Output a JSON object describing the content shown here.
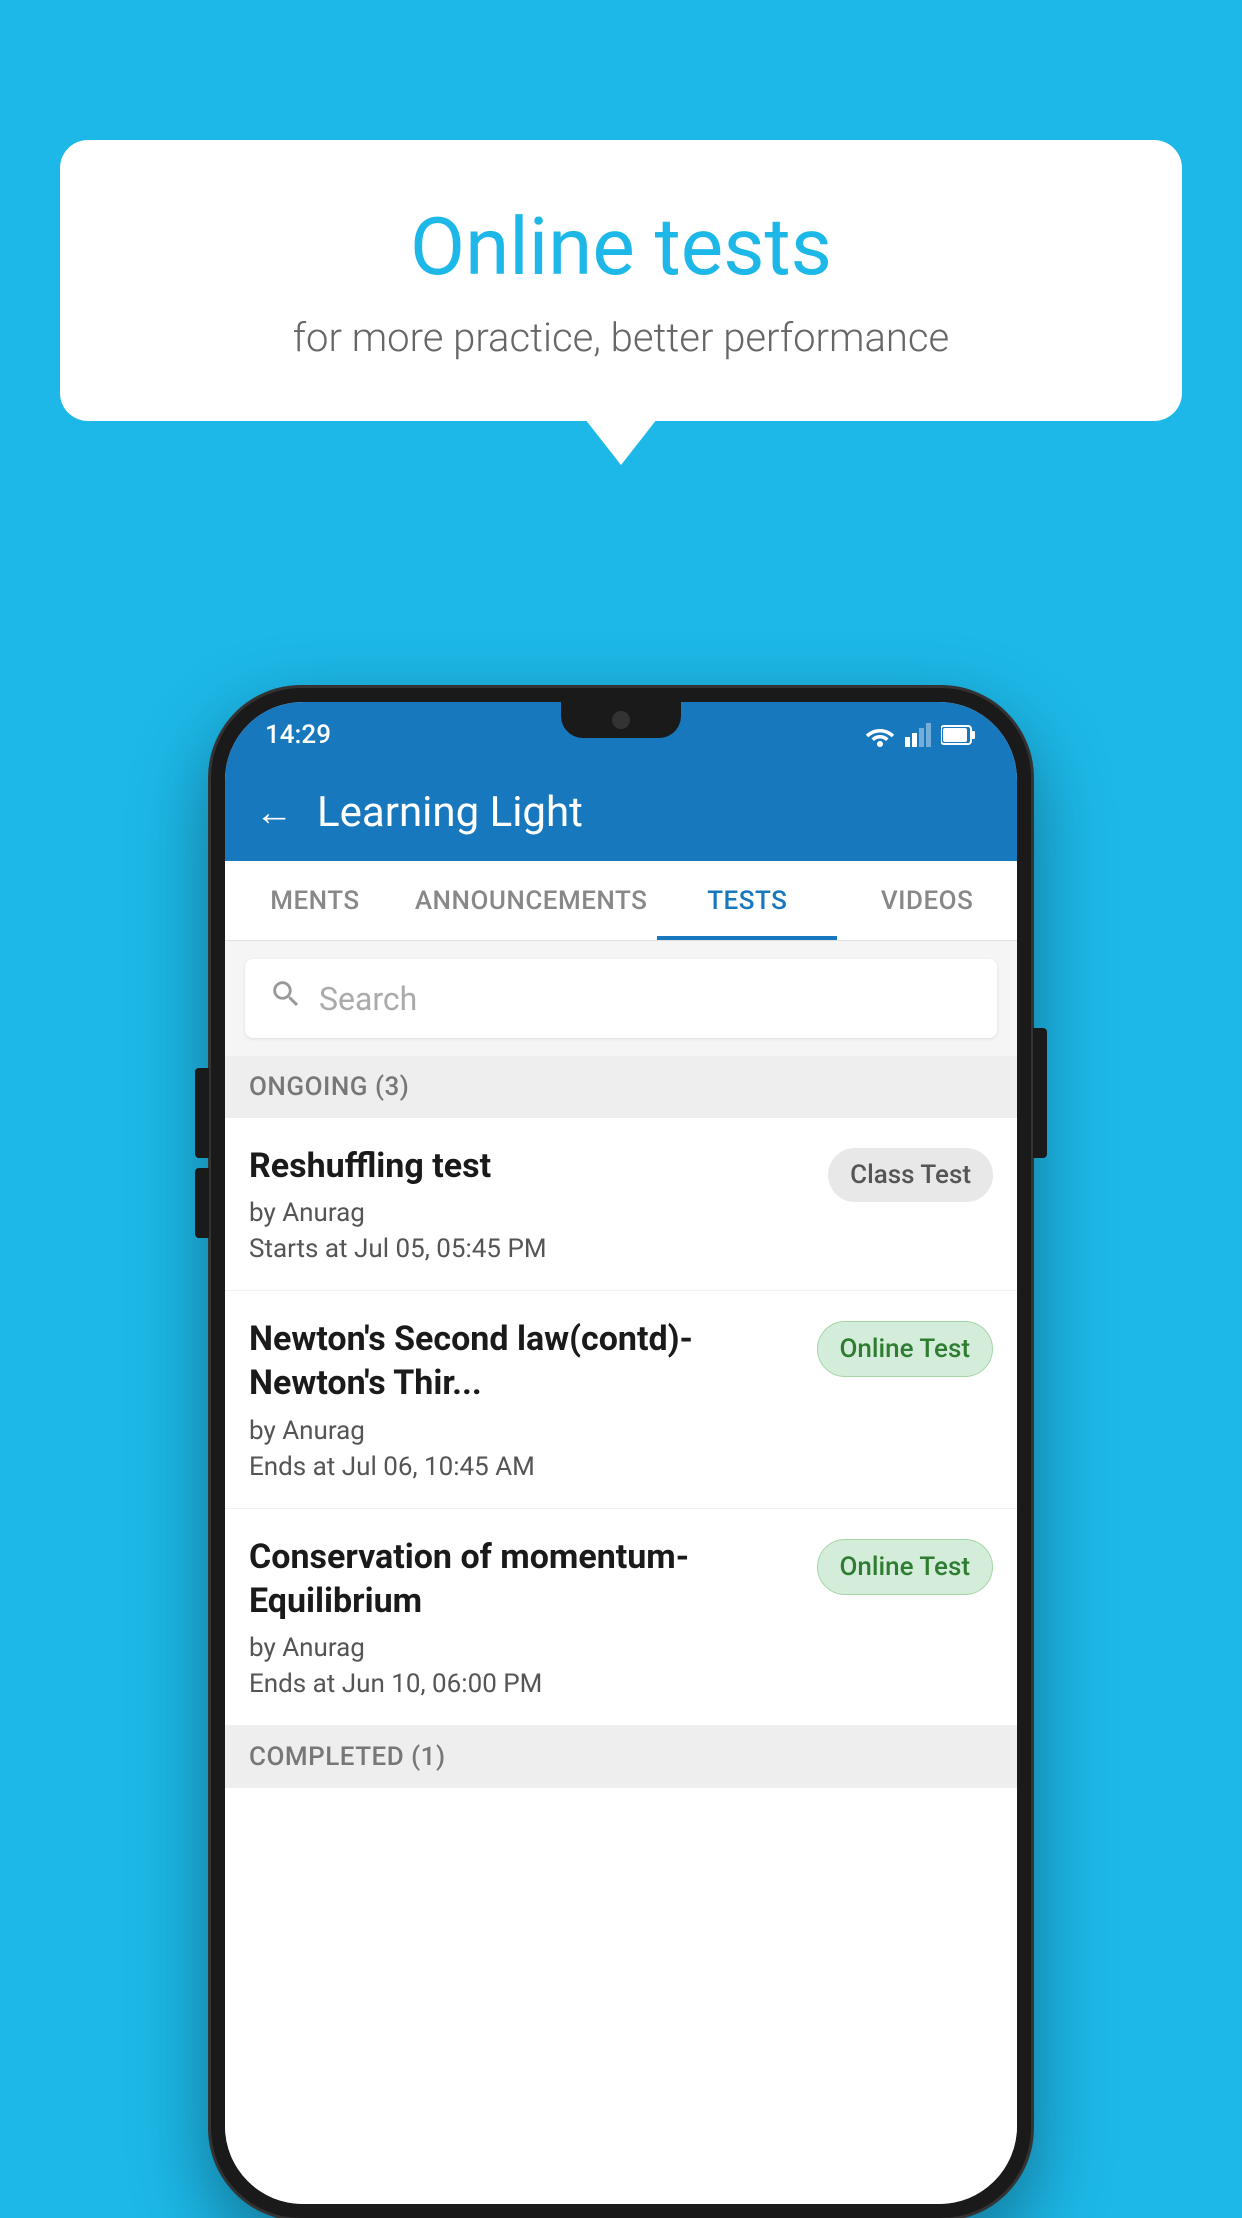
{
  "background": {
    "color": "#1DB8E8"
  },
  "speech_bubble": {
    "title": "Online tests",
    "subtitle": "for more practice, better performance"
  },
  "phone": {
    "status_bar": {
      "time": "14:29",
      "icons": [
        "wifi",
        "signal",
        "battery"
      ]
    },
    "app_header": {
      "back_label": "←",
      "title": "Learning Light"
    },
    "tabs": [
      {
        "label": "MENTS",
        "active": false
      },
      {
        "label": "ANNOUNCEMENTS",
        "active": false
      },
      {
        "label": "TESTS",
        "active": true
      },
      {
        "label": "VIDEOS",
        "active": false
      }
    ],
    "search": {
      "placeholder": "Search"
    },
    "ongoing_section": {
      "label": "ONGOING (3)"
    },
    "tests": [
      {
        "name": "Reshuffling test",
        "author": "by Anurag",
        "date_label": "Starts at",
        "date": "Jul 05, 05:45 PM",
        "badge": "Class Test",
        "badge_type": "class"
      },
      {
        "name": "Newton's Second law(contd)-Newton's Thir...",
        "author": "by Anurag",
        "date_label": "Ends at",
        "date": "Jul 06, 10:45 AM",
        "badge": "Online Test",
        "badge_type": "online"
      },
      {
        "name": "Conservation of momentum-Equilibrium",
        "author": "by Anurag",
        "date_label": "Ends at",
        "date": "Jun 10, 06:00 PM",
        "badge": "Online Test",
        "badge_type": "online"
      }
    ],
    "completed_section": {
      "label": "COMPLETED (1)"
    }
  }
}
